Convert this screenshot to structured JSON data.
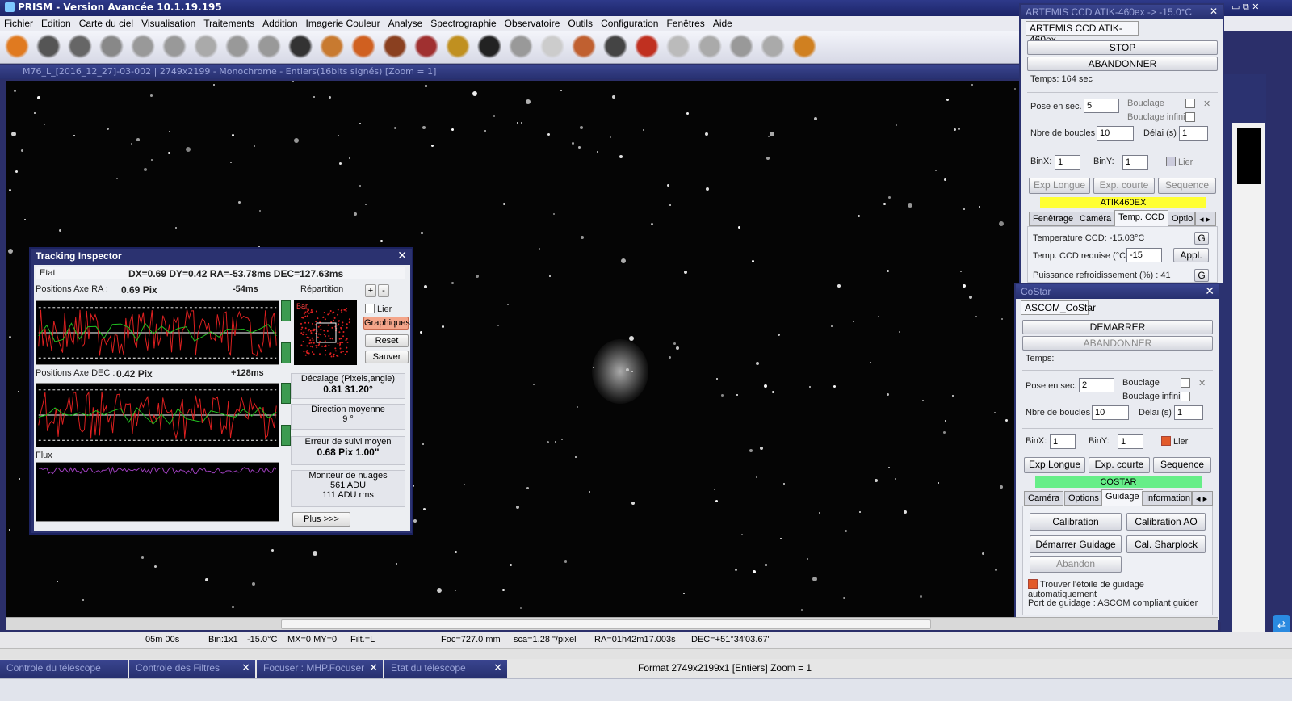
{
  "app": {
    "title": "PRISM - Version Avancée  10.1.19.195"
  },
  "menu": [
    "Fichier",
    "Edition",
    "Carte du ciel",
    "Visualisation",
    "Traitements",
    "Addition",
    "Imagerie Couleur",
    "Analyse",
    "Spectrographie",
    "Observatoire",
    "Outils",
    "Configuration",
    "Fenêtres",
    "Aide"
  ],
  "toolbar_icons": [
    "sun-icon",
    "save-icon",
    "camera-icon",
    "info-icon",
    "telescope-icon",
    "mount-icon",
    "half-moon-icon",
    "crosshair-icon",
    "pointer-crosshair-icon",
    "zoom-icon",
    "filter-wheel-icon",
    "camera1-icon",
    "camera2-icon",
    "camera3-icon",
    "focuser-icon",
    "observatory-icon",
    "star-icon",
    "sphere-icon",
    "guide-icon",
    "sequence-icon",
    "magnet-icon",
    "curve-icon",
    "hand-icon",
    "square-icon",
    "graph-icon",
    "astronomer-icon"
  ],
  "image_window": {
    "title": "M76_L_[2016_12_27]-03-002 | 2749x2199 - Monochrome - Entiers(16bits signés)  [Zoom = 1]"
  },
  "status": {
    "exposure": "05m 00s",
    "bin": "Bin:1x1",
    "temp": "-15.0°C",
    "mx": "MX=0 MY=0",
    "filt": "Filt.=L",
    "foc": "Foc=727.0 mm",
    "sca": "sca=1.28 \"/pixel",
    "ra": "RA=01h42m17.003s",
    "dec": "DEC=+51°34'03.67\""
  },
  "bottom_tabs": [
    "Controle du télescope",
    "Controle des Filtres",
    "Focuser : MHP.Focuser",
    "Etat du télescope"
  ],
  "format_text": "Format 2749x2199x1 [Entiers]  Zoom = 1",
  "tracking": {
    "title": "Tracking Inspector",
    "etat_label": "Etat",
    "etat_value": "DX=0.69  DY=0.42  RA=-53.78ms  DEC=127.63ms",
    "ra_label": "Positions Axe RA :",
    "ra_pix": "0.69 Pix",
    "ra_ms": "-54ms",
    "dec_label": "Positions Axe DEC :",
    "dec_pix": "0.42 Pix",
    "dec_ms": "+128ms",
    "flux_label": "Flux",
    "repartition": "Répartition",
    "plus": "+",
    "minus": "-",
    "bar": "Bar.",
    "lier": "Lier",
    "graphiques": "Graphiques",
    "reset": "Reset",
    "sauver": "Sauver",
    "decalage_label": "Décalage (Pixels,angle)",
    "decalage_value": "0.81   31.20°",
    "direction_label": "Direction moyenne",
    "direction_value": "9 °",
    "erreur_label": "Erreur de suivi moyen",
    "erreur_value": "0.68 Pix   1.00\"",
    "moniteur_label": "Moniteur de nuages",
    "moniteur_adu": "561 ADU",
    "moniteur_rms": "111 ADU rms",
    "plus_btn": "Plus >>>"
  },
  "artemis": {
    "title": "ARTEMIS CCD ATIK-460ex   ->  -15.0°C",
    "tab": "ARTEMIS CCD ATIK-460ex",
    "stop": "STOP",
    "abandon": "ABANDONNER",
    "temps": "Temps: 164 sec",
    "pose_label": "Pose en sec.",
    "pose_value": "5",
    "bouclage": "Bouclage",
    "bouclage_infini": "Bouclage infini",
    "nbre_label": "Nbre de boucles",
    "nbre_value": "10",
    "delai_label": "Délai (s)",
    "delai_value": "1",
    "binx_label": "BinX:",
    "binx_value": "1",
    "biny_label": "BinY:",
    "biny_value": "1",
    "lier": "Lier",
    "exp_longue": "Exp Longue",
    "exp_courte": "Exp. courte",
    "sequence": "Sequence",
    "device": "ATIK460EX",
    "tabs": [
      "Fenêtrage",
      "Caméra",
      "Temp. CCD",
      "Optio"
    ],
    "temp_ccd": "Temperature CCD: -15.03°C",
    "temp_req_label": "Temp. CCD requise (°C)",
    "temp_req_value": "-15",
    "appl": "Appl.",
    "g": "G",
    "puissance": "Puissance refroidissement (%) : 41"
  },
  "costar": {
    "title": "CoStar",
    "tab": "ASCOM_CoStar",
    "demarrer": "DEMARRER",
    "abandon": "ABANDONNER",
    "temps": "Temps:",
    "pose_label": "Pose en sec.",
    "pose_value": "2",
    "bouclage": "Bouclage",
    "bouclage_infini": "Bouclage infini",
    "nbre_label": "Nbre de boucles",
    "nbre_value": "10",
    "delai_label": "Délai (s)",
    "delai_value": "1",
    "binx_label": "BinX:",
    "binx_value": "1",
    "biny_label": "BinY:",
    "biny_value": "1",
    "lier": "Lier",
    "exp_longue": "Exp Longue",
    "exp_courte": "Exp. courte",
    "sequence": "Sequence",
    "device": "COSTAR",
    "tabs": [
      "Caméra",
      "Options",
      "Guidage",
      "Information"
    ],
    "calibration": "Calibration",
    "calibration_ao": "Calibration AO",
    "demarrer_guidage": "Démarrer Guidage",
    "cal_sharplock": "Cal. Sharplock",
    "abandon_btn": "Abandon",
    "auto_star": "Trouver l'étoile de guidage automatiquement",
    "port": "Port de guidage : ASCOM compliant guider"
  },
  "colors": {
    "device_yellow": "#ffff33",
    "device_green": "#66ee88",
    "trace_red": "#e02020",
    "trace_green": "#20c020",
    "flux_purple": "#a040c0"
  }
}
